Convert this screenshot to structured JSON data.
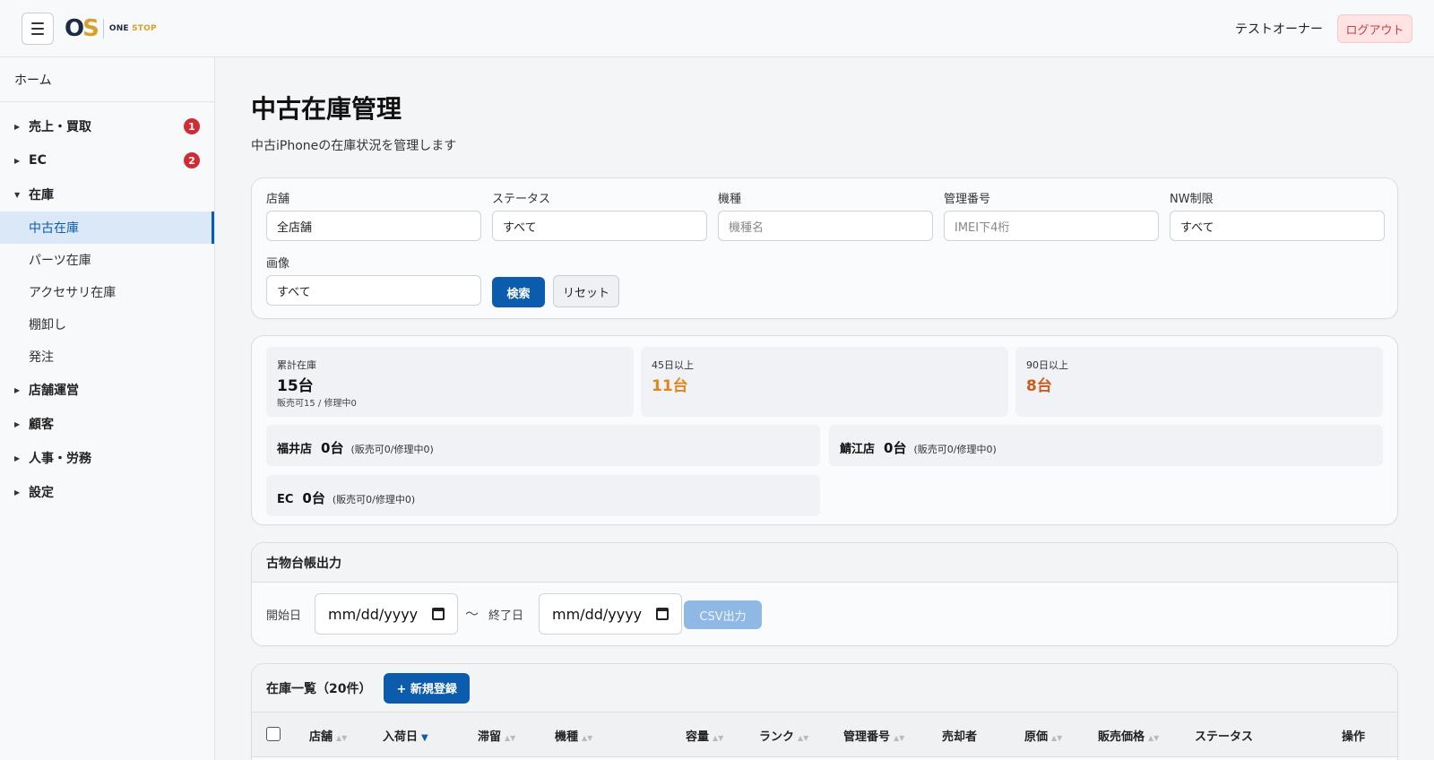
{
  "header": {
    "logo_mark_o": "O",
    "logo_mark_s": "S",
    "logo_one": "ONE",
    "logo_stop": "STOP",
    "user_name": "テストオーナー",
    "logout_label": "ログアウト"
  },
  "sidebar": {
    "home": "ホーム",
    "groups": [
      {
        "label": "売上・買取",
        "badge": "1",
        "expanded": false
      },
      {
        "label": "EC",
        "badge": "2",
        "expanded": false
      },
      {
        "label": "在庫",
        "badge": null,
        "expanded": true
      },
      {
        "label": "店舗運営",
        "badge": null,
        "expanded": false
      },
      {
        "label": "顧客",
        "badge": null,
        "expanded": false
      },
      {
        "label": "人事・労務",
        "badge": null,
        "expanded": false
      },
      {
        "label": "設定",
        "badge": null,
        "expanded": false
      }
    ],
    "inventory_items": [
      "中古在庫",
      "パーツ在庫",
      "アクセサリ在庫",
      "棚卸し",
      "発注"
    ],
    "active_item": "中古在庫"
  },
  "page": {
    "title": "中古在庫管理",
    "subtitle": "中古iPhoneの在庫状況を管理します"
  },
  "filters": {
    "store": {
      "label": "店舗",
      "value": "全店舗"
    },
    "status": {
      "label": "ステータス",
      "value": "すべて"
    },
    "model": {
      "label": "機種",
      "placeholder": "機種名"
    },
    "mgmt_no": {
      "label": "管理番号",
      "placeholder": "IMEI下4桁"
    },
    "nw": {
      "label": "NW制限",
      "value": "すべて"
    },
    "image": {
      "label": "画像",
      "value": "すべて"
    },
    "search_label": "検索",
    "reset_label": "リセット"
  },
  "stats": {
    "total": {
      "label": "累計在庫",
      "value": "15台",
      "note": "販売可15 / 修理中0"
    },
    "over45": {
      "label": "45日以上",
      "value": "11台"
    },
    "over90": {
      "label": "90日以上",
      "value": "8台"
    },
    "stores": [
      {
        "name": "福井店",
        "count": "0台",
        "detail": "(販売可0/修理中0)"
      },
      {
        "name": "鯖江店",
        "count": "0台",
        "detail": "(販売可0/修理中0)"
      },
      {
        "name": "EC",
        "count": "0台",
        "detail": "(販売可0/修理中0)"
      }
    ],
    "colors": {
      "over45": "#e0861c",
      "over90": "#cc5a18"
    }
  },
  "export": {
    "title": "古物台帳出力",
    "start_label": "開始日",
    "end_label": "終了日",
    "date_placeholder": "mm/dd/yyyy",
    "tilde": "〜",
    "csv_label": "CSV出力"
  },
  "list": {
    "title": "在庫一覧（20件）",
    "new_label": "+ 新規登録",
    "columns": [
      "店舗",
      "入荷日",
      "滞留",
      "機種",
      "容量",
      "ランク",
      "管理番号",
      "売却者",
      "原価",
      "販売価格",
      "ステータス",
      "操作"
    ],
    "sorted_column": "入荷日"
  },
  "icons": {
    "menu": "hamburger-icon",
    "calendar": "calendar-icon",
    "sort": "sort-icon",
    "caret": "caret-icon"
  },
  "accent_color": "#0b5cad"
}
